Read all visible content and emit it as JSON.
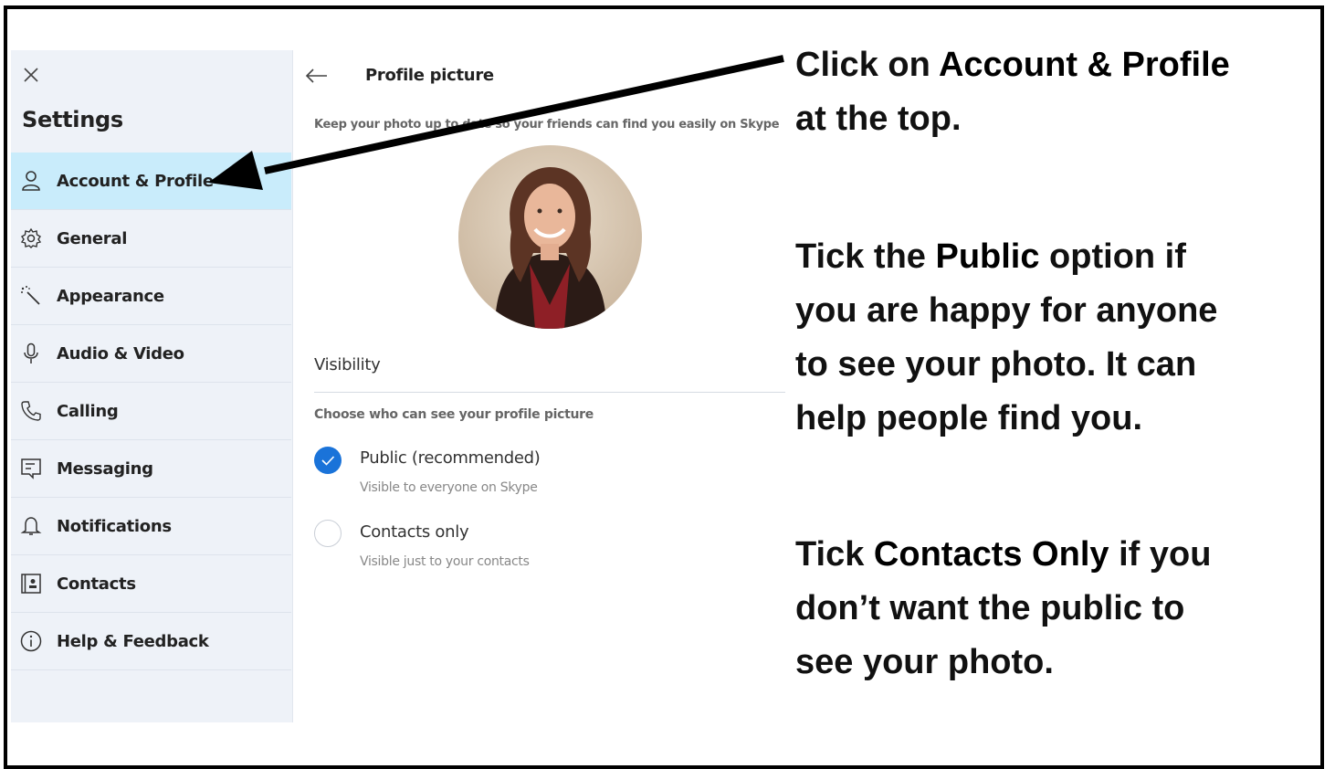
{
  "sidebar": {
    "title": "Settings",
    "items": [
      {
        "label": "Account & Profile",
        "icon": "person-icon",
        "active": true
      },
      {
        "label": "General",
        "icon": "gear-icon",
        "active": false
      },
      {
        "label": "Appearance",
        "icon": "magic-wand-icon",
        "active": false
      },
      {
        "label": "Audio & Video",
        "icon": "microphone-icon",
        "active": false
      },
      {
        "label": "Calling",
        "icon": "phone-icon",
        "active": false
      },
      {
        "label": "Messaging",
        "icon": "message-icon",
        "active": false
      },
      {
        "label": "Notifications",
        "icon": "bell-icon",
        "active": false
      },
      {
        "label": "Contacts",
        "icon": "contact-card-icon",
        "active": false
      },
      {
        "label": "Help & Feedback",
        "icon": "info-icon",
        "active": false
      }
    ]
  },
  "main": {
    "title": "Profile picture",
    "hint": "Keep your photo up to date so your friends can find you easily on Skype",
    "visibility": {
      "title": "Visibility",
      "hint": "Choose who can see your profile picture",
      "options": [
        {
          "label": "Public (recommended)",
          "sub": "Visible to everyone on Skype",
          "selected": true
        },
        {
          "label": "Contacts only",
          "sub": "Visible just to your contacts",
          "selected": false
        }
      ]
    }
  },
  "annotations": {
    "a1": {
      "p1": "Click on ",
      "b1": "Account & Profile",
      "p2": "at the top."
    },
    "a2": {
      "p1": "Tick the ",
      "b1": "Public",
      "p2": " option if",
      "l2": "you are happy for anyone",
      "l3": "to see your photo. It can",
      "l4": "help people find you."
    },
    "a3": {
      "p1": "Tick ",
      "b1": "Contacts Only",
      "p2": " if you",
      "l2": "don’t want the public to",
      "l3": "see your photo."
    }
  },
  "colors": {
    "accent": "#1a73d9",
    "active_bg": "#c9ecfb",
    "sidebar_bg": "#eef2f8"
  }
}
